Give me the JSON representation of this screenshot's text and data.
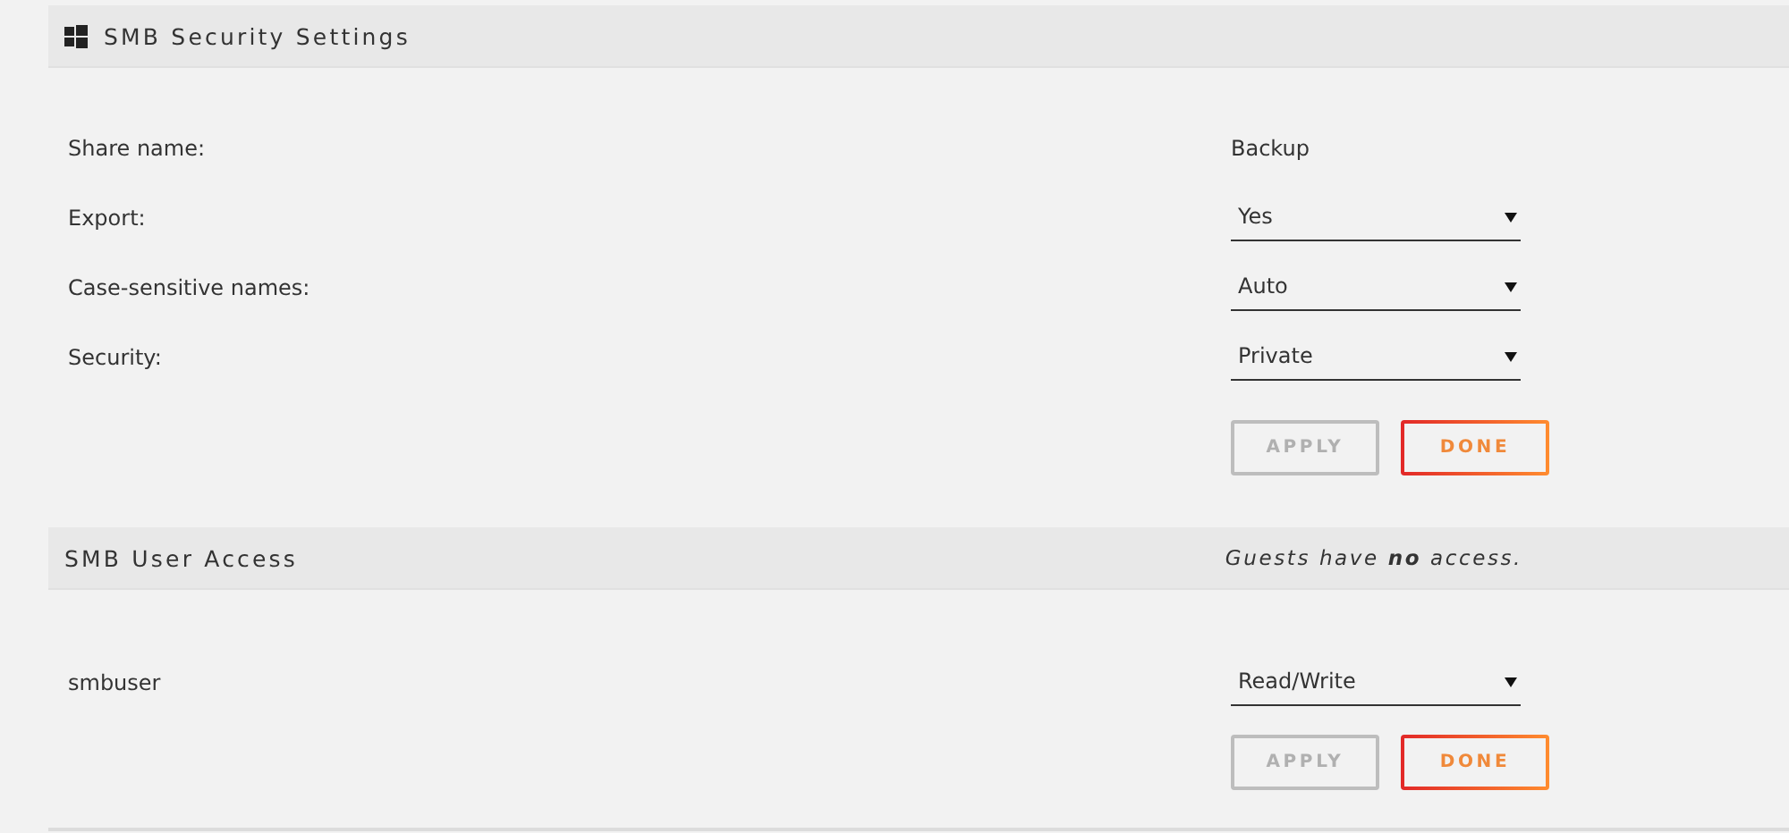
{
  "sections": [
    {
      "title": "SMB Security Settings",
      "icon": true,
      "rows": [
        {
          "label": "Share name:",
          "kind": "text",
          "value": "Backup"
        },
        {
          "label": "Export:",
          "kind": "select",
          "value": "Yes"
        },
        {
          "label": "Case-sensitive names:",
          "kind": "select",
          "value": "Auto"
        },
        {
          "label": "Security:",
          "kind": "select",
          "value": "Private"
        }
      ],
      "buttons": [
        {
          "label": "APPLY",
          "disabled": true
        },
        {
          "label": "DONE",
          "disabled": false
        }
      ]
    },
    {
      "title": "SMB User Access",
      "icon": false,
      "note": "Guests have **no** access.",
      "rows": [
        {
          "label": "smbuser",
          "kind": "select",
          "value": "Read/Write"
        }
      ],
      "buttons": [
        {
          "label": "APPLY",
          "disabled": true
        },
        {
          "label": "DONE",
          "disabled": false
        }
      ]
    }
  ]
}
